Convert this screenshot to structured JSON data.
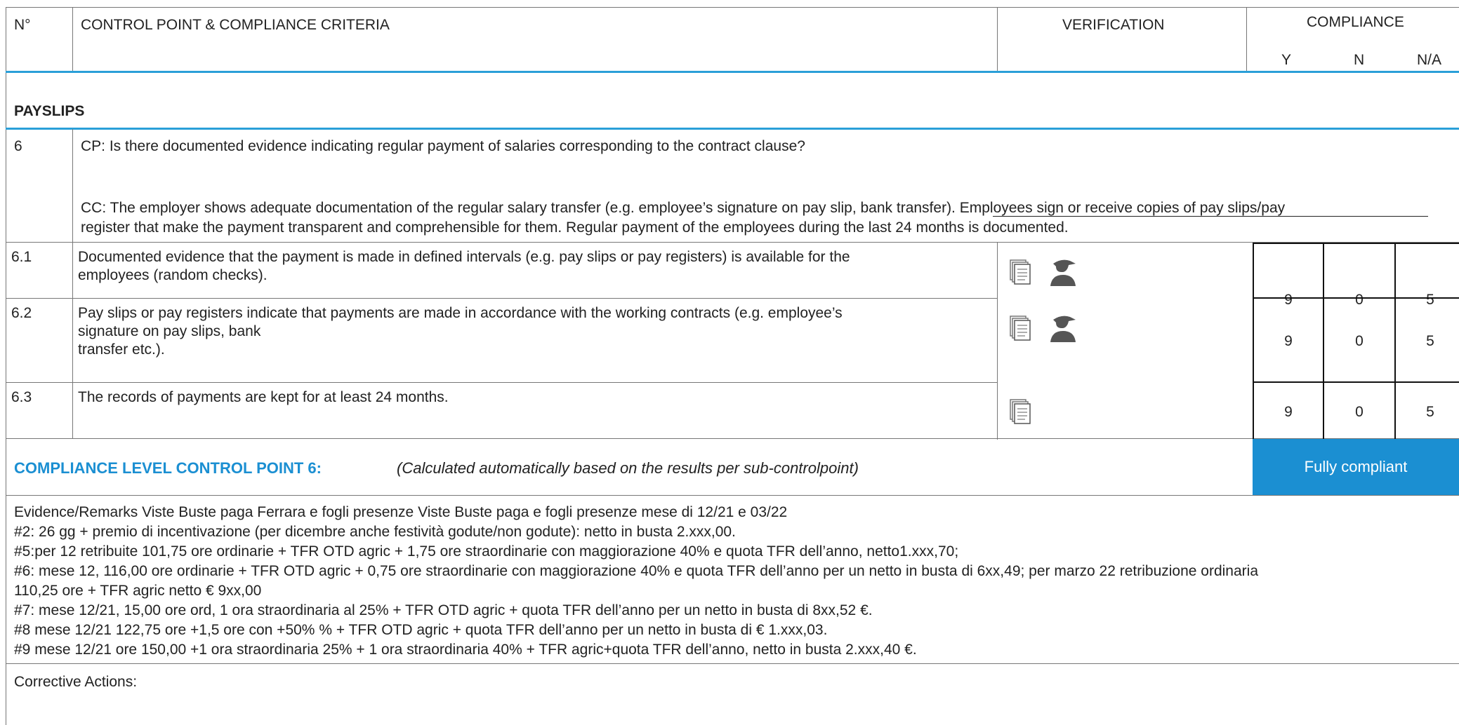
{
  "header": {
    "no": "N°",
    "criteria": "CONTROL POINT & COMPLIANCE CRITERIA",
    "verification": "VERIFICATION",
    "compliance": "COMPLIANCE",
    "y": "Y",
    "n": "N",
    "na": "N/A"
  },
  "section": {
    "title": "PAYSLIPS"
  },
  "cp": {
    "number": "6",
    "question": "CP: Is there documented evidence indicating regular payment of salaries corresponding to the contract clause?",
    "criteria_line1": "CC: The employer shows adequate documentation of the regular salary transfer (e.g. employee’s signature on pay slip, bank transfer). Employees sign or receive copies of pay slips/pay",
    "criteria_line2": "register that make the payment transparent and comprehensible for them. Regular payment of the employees during the last 24 months is documented."
  },
  "rows": [
    {
      "number": "6.1",
      "line1": "Documented evidence that the payment is made in defined intervals (e.g. pay slips or pay registers) is available for the",
      "line2": "employees (random checks).",
      "line3": "",
      "y": "9",
      "n": "0",
      "na": "5",
      "icons": [
        "document-icon",
        "interview-person-icon"
      ]
    },
    {
      "number": "6.2",
      "line1": "Pay slips or pay registers indicate that payments are made in accordance with the working contracts (e.g. employee’s",
      "line2": "signature on pay slips, bank",
      "line3": "transfer etc.).",
      "y": "9",
      "n": "0",
      "na": "5",
      "icons": [
        "document-icon",
        "interview-person-icon"
      ]
    },
    {
      "number": "6.3",
      "line1": "The records of payments are kept for at least 24 months.",
      "line2": "",
      "line3": "",
      "y": "9",
      "n": "0",
      "na": "5",
      "icons": [
        "document-icon"
      ]
    }
  ],
  "compliance_level": {
    "label": "COMPLIANCE LEVEL CONTROL POINT 6:",
    "note": "(Calculated automatically based on the results per sub-controlpoint)",
    "result": "Fully compliant",
    "result_color": "#1b8fd2"
  },
  "evidence": {
    "lines": [
      "Evidence/Remarks Viste Buste paga Ferrara e fogli presenze Viste Buste paga e fogli presenze mese di 12/21 e 03/22",
      "#2: 26 gg + premio di incentivazione (per dicembre anche festività godute/non godute): netto in busta 2.xxx,00.",
      "#5:per 12 retribuite 101,75 ore ordinarie + TFR OTD agric + 1,75 ore straordinarie con maggiorazione 40% e quota TFR dell’anno, netto1.xxx,70;",
      "#6: mese 12, 116,00 ore ordinarie + TFR OTD agric + 0,75 ore straordinarie con maggiorazione 40% e quota TFR dell’anno per un netto in busta di 6xx,49; per marzo 22 retribuzione ordinaria",
      "110,25 ore + TFR agric netto € 9xx,00",
      "#7: mese 12/21, 15,00 ore ord, 1 ora straordinaria al 25% + TFR OTD agric + quota TFR dell’anno per un netto in busta di 8xx,52 €.",
      "#8 mese 12/21 122,75 ore +1,5 ore con +50% % + TFR OTD agric + quota TFR dell’anno per un netto in busta di € 1.xxx,03.",
      "#9 mese 12/21 ore 150,00 +1 ora straordinaria 25% + 1 ora straordinaria 40% + TFR agric+quota TFR dell’anno, netto in busta 2.xxx,40 €."
    ]
  },
  "corrective": {
    "label": "Corrective Actions:"
  }
}
